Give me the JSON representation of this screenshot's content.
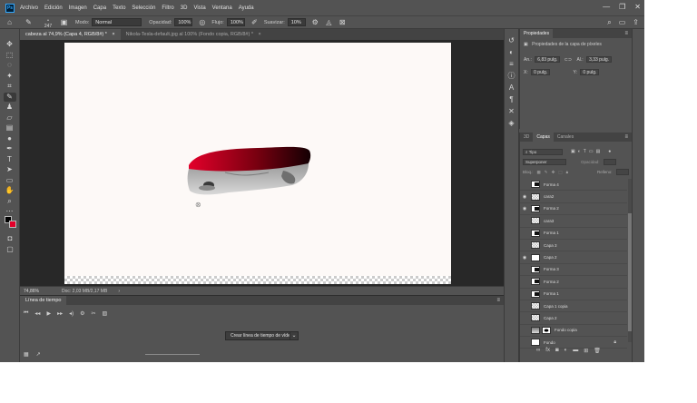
{
  "menubar": {
    "logo": "Ps",
    "items": [
      "Archivo",
      "Edición",
      "Imagen",
      "Capa",
      "Texto",
      "Selección",
      "Filtro",
      "3D",
      "Vista",
      "Ventana",
      "Ayuda"
    ],
    "controls": [
      "—",
      "❐",
      "✕"
    ]
  },
  "options": {
    "brush_size": "247",
    "mode_label": "Modo:",
    "mode_value": "Normal",
    "opacity_label": "Opacidad:",
    "opacity_value": "100%",
    "flow_label": "Flujo:",
    "flow_value": "100%",
    "smooth_label": "Suavizar:",
    "smooth_value": "10%"
  },
  "doc_tabs": [
    {
      "label": "cabeza al 74,9% (Capa 4, RGB/8#) *",
      "close": "×"
    },
    {
      "label": "Nikola-Tesla-default.jpg al 100% (Fondo copia, RGB/8#) *",
      "close": "×"
    }
  ],
  "status": {
    "zoom": "74,86%",
    "doc": "Doc: 2,03 MB/2,17 MB"
  },
  "timeline": {
    "title": "Línea de tiempo",
    "create_button": "Crear línea de tiempo de vídeo"
  },
  "properties": {
    "tab": "Propiedades",
    "subtitle": "Propiedades de la capa de píxeles",
    "an_label": "An.:",
    "an_value": "6,83 pulg.",
    "al_label": "Al.:",
    "al_value": "3,33 pulg.",
    "x_label": "X:",
    "x_value": "0 pulg.",
    "y_label": "Y:",
    "y_value": "0 pulg."
  },
  "layers_panel": {
    "tabs": [
      "3D",
      "Capas",
      "Canales"
    ],
    "filter_value": "Tipo",
    "blend_value": "Superponer",
    "opacity_label": "Opacidad:",
    "lock_label": "Bloq.:",
    "fill_label": "Relleno:",
    "layers": [
      {
        "name": "Forma 4",
        "visible": false,
        "thumb": "shape"
      },
      {
        "name": "cara2",
        "visible": true,
        "thumb": "checker"
      },
      {
        "name": "Forma 2",
        "visible": true,
        "thumb": "shape"
      },
      {
        "name": "cara3",
        "visible": false,
        "thumb": "checker"
      },
      {
        "name": "Forma 1",
        "visible": false,
        "thumb": "shape"
      },
      {
        "name": "Capa 3",
        "visible": false,
        "thumb": "checker"
      },
      {
        "name": "Capa 2",
        "visible": true,
        "thumb": "white"
      },
      {
        "name": "Forma 3",
        "visible": false,
        "thumb": "shape"
      },
      {
        "name": "Forma 2",
        "visible": false,
        "thumb": "shape"
      },
      {
        "name": "Forma 1",
        "visible": false,
        "thumb": "shape"
      },
      {
        "name": "Capa 1 copia",
        "visible": false,
        "thumb": "checker"
      },
      {
        "name": "Capa 2",
        "visible": false,
        "thumb": "checker"
      },
      {
        "name": "Fondo copia",
        "visible": false,
        "thumb": "photo"
      },
      {
        "name": "Fondo",
        "visible": false,
        "thumb": "white",
        "locked": true
      }
    ]
  },
  "colors": {
    "foreground": "#000000",
    "background": "#e3002a",
    "accent": "#31a8ff"
  }
}
